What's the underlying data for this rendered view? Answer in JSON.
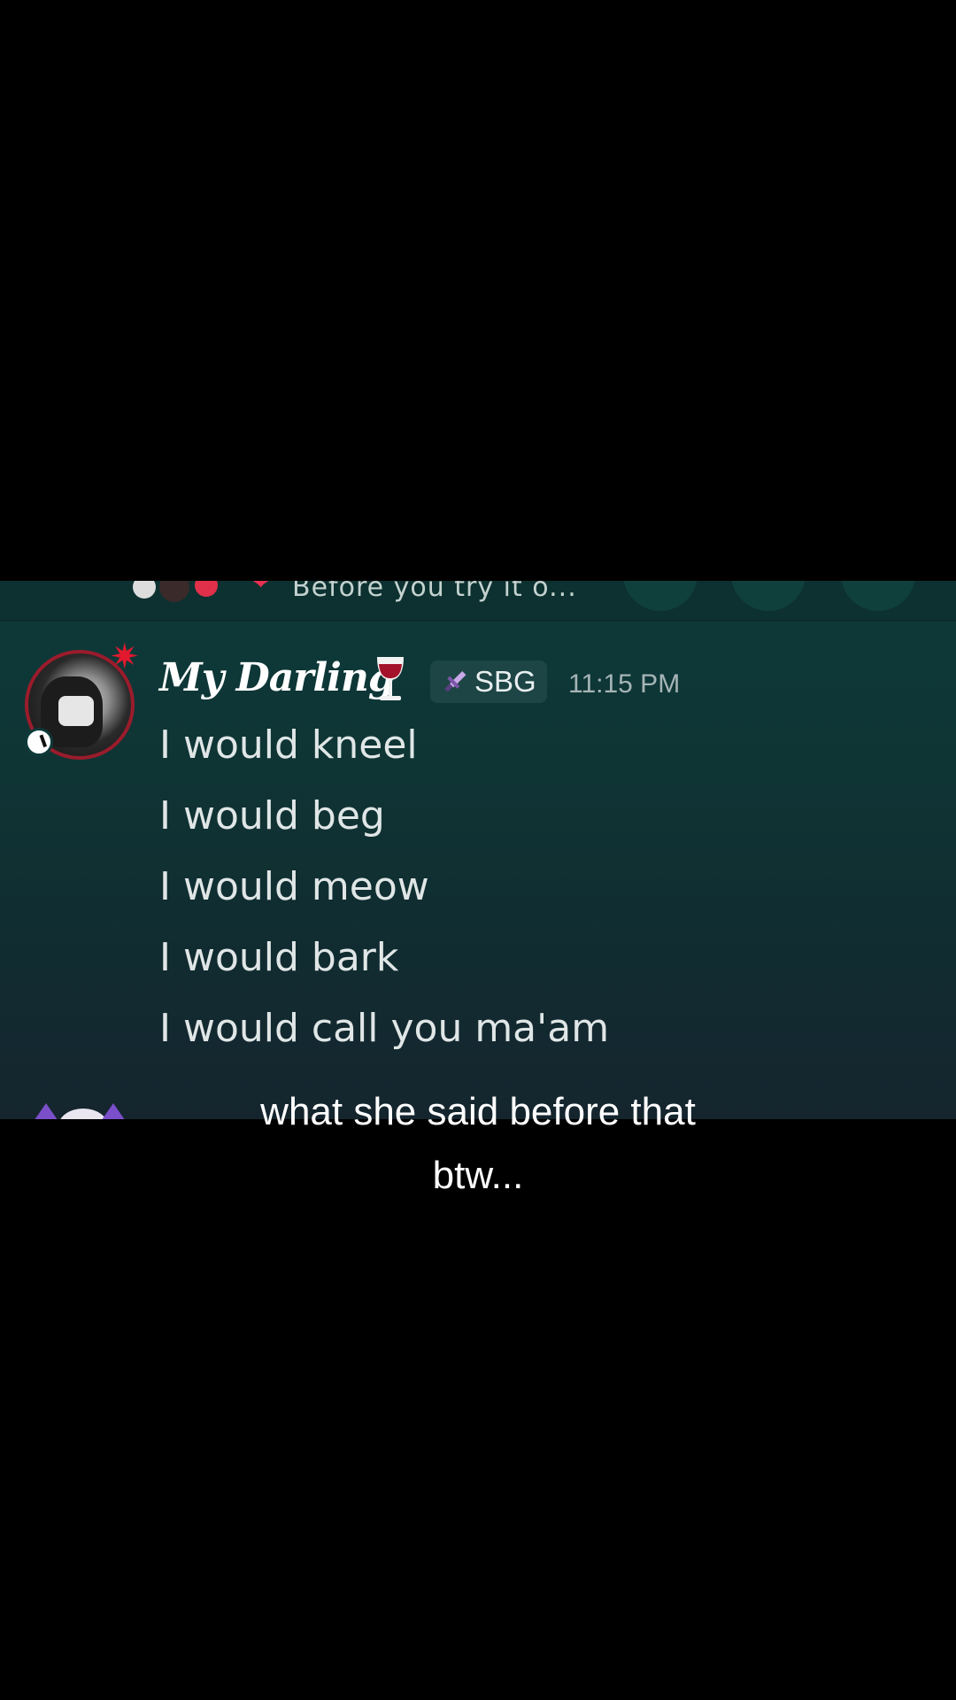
{
  "reply_preview": {
    "text": "Before you try it o..."
  },
  "message": {
    "author": "My Darling",
    "author_emoji": "wine-glass-icon",
    "role_tag": "SBG",
    "role_icon": "sword-icon",
    "timestamp": "11:15 PM",
    "lines": [
      "I would kneel",
      "I would beg",
      "I would meow",
      "I would bark",
      "I would call you ma'am"
    ]
  },
  "caption": {
    "line1": "what she said before that",
    "line2": "btw..."
  },
  "colors": {
    "background": "#000000",
    "chat_bg_top": "#0e3a3a",
    "chat_bg_bottom": "#15252e",
    "username": "#ffffff",
    "message_text": "#e0e6e6",
    "timestamp": "#a6b4b6",
    "role_tag_bg": "#1d4545",
    "accent_red": "#e0192e"
  }
}
